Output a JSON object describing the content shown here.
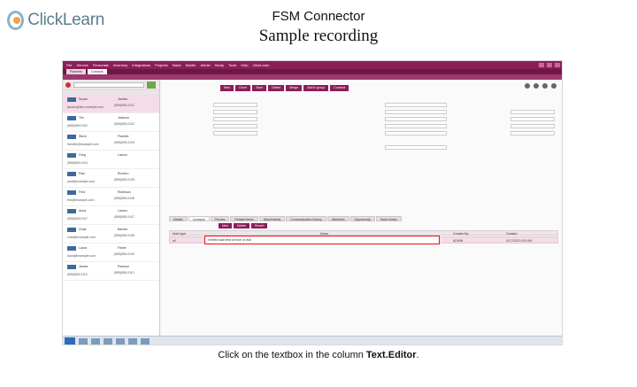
{
  "brand": {
    "name": "ClickLearn"
  },
  "slide": {
    "title": "FSM Connector",
    "subtitle": "Sample recording",
    "caption_prefix": "Click on the textbox in the column ",
    "caption_target": "Text.Editor",
    "caption_suffix": "."
  },
  "app": {
    "menu": [
      "File",
      "Service",
      "Financials",
      "Inventory",
      "Integrations",
      "Projects",
      "Sales",
      "Mobile",
      "Admin",
      "Study",
      "Tools",
      "Help",
      "ClickLearn"
    ],
    "tabs": [
      "Planners",
      "Contacts"
    ],
    "toolbar_buttons": [
      "New",
      "Clone",
      "Save",
      "Delete",
      "Merge",
      "Add to group",
      "Connect"
    ],
    "detail_tabs": [
      "Details",
      "Contacts",
      "Phones",
      "Related items",
      "Attachments",
      "Communication history",
      "Attributes",
      "Opportunity",
      "Sales Notes"
    ],
    "sub_buttons": [
      "New",
      "Delete",
      "Revert"
    ],
    "grid": {
      "headers": [
        "Note type",
        "Notes",
        "Created By",
        "Created"
      ],
      "row": {
        "type": "all",
        "text": "Verified wait time at time of visit",
        "created_by": "ADMIN",
        "created": "4/17/2023 9:51 AM"
      }
    },
    "contacts": [
      {
        "first": "Susan",
        "last": "Jacobs",
        "email": "jacobs@fsm.example.com",
        "phone": "(555)555-0101"
      },
      {
        "first": "Tim",
        "last": "Jackson",
        "email": "(555)555-0102",
        "phone": "(555)555-0102"
      },
      {
        "first": "Steve",
        "last": "Franklin",
        "email": "franklin@example.com",
        "phone": "(555)555-0103"
      },
      {
        "first": "Greg",
        "last": "Larson",
        "email": "(555)555-0104",
        "phone": ""
      },
      {
        "first": "Paul",
        "last": "Romero",
        "email": "paul@example.com",
        "phone": "(555)555-0105"
      },
      {
        "first": "Fred",
        "last": "Robinson",
        "email": "fred@example.com",
        "phone": "(555)555-0106"
      },
      {
        "first": "Anna",
        "last": "Larsen",
        "email": "(555)555-0107",
        "phone": "(555)555-0107"
      },
      {
        "first": "Chad",
        "last": "Barnes",
        "email": "chad@example.com",
        "phone": "(555)555-0108"
      },
      {
        "first": "Laura",
        "last": "Fisher",
        "email": "laura@example.com",
        "phone": "(555)555-0109"
      },
      {
        "first": "James",
        "last": "Pearson",
        "email": "(555)555-0110",
        "phone": "(555)555-0110"
      }
    ]
  }
}
